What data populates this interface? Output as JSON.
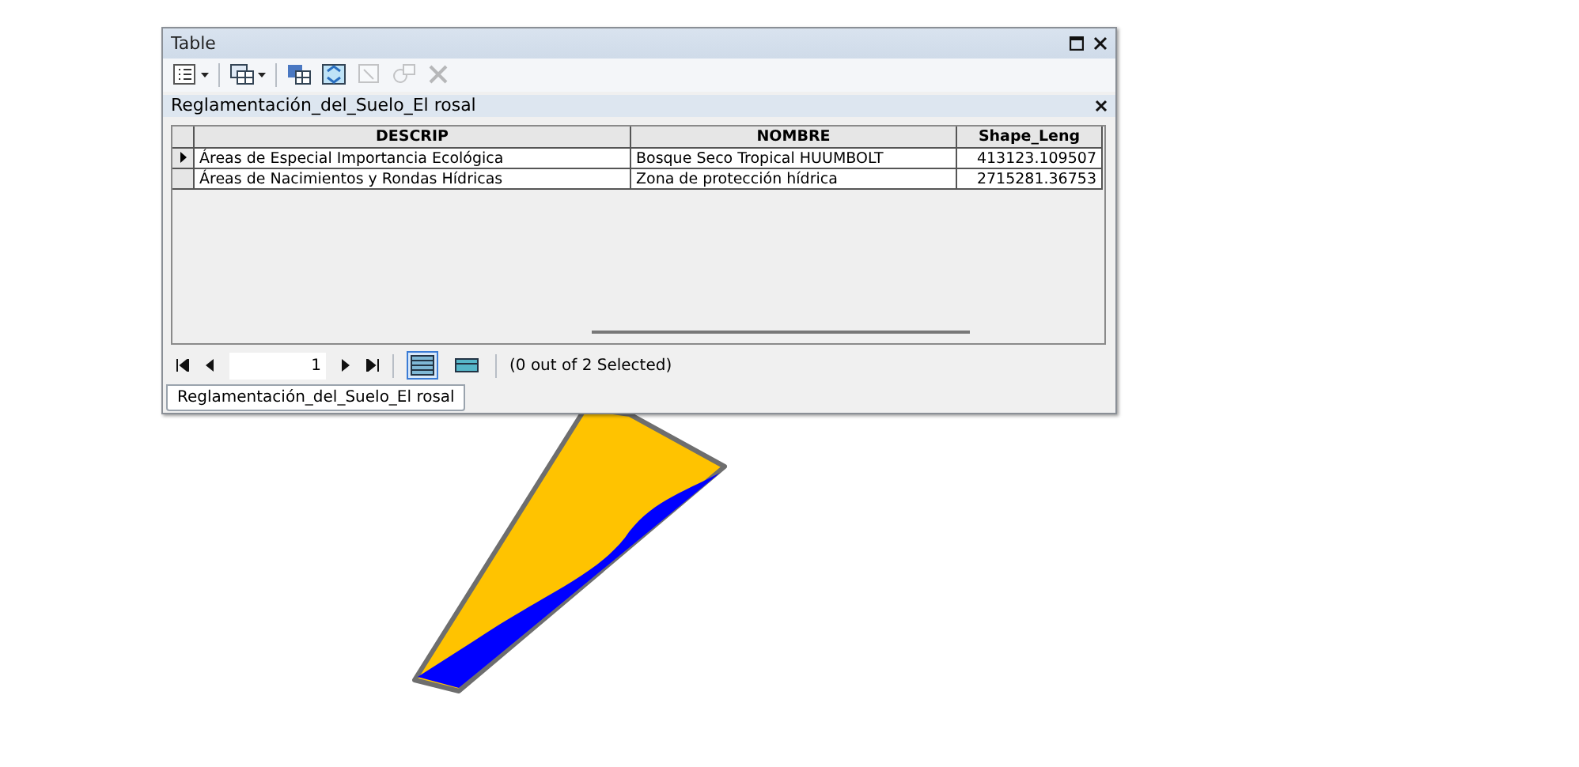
{
  "window": {
    "title": "Table"
  },
  "toolbar": [
    {
      "kind": "options",
      "dropdown": true,
      "disabled": false
    },
    {
      "kind": "related",
      "dropdown": true,
      "disabled": false
    },
    {
      "kind": "select",
      "dropdown": false,
      "disabled": false
    },
    {
      "kind": "switch",
      "dropdown": false,
      "disabled": false
    },
    {
      "kind": "clear",
      "dropdown": false,
      "disabled": true
    },
    {
      "kind": "zoom",
      "dropdown": false,
      "disabled": true
    },
    {
      "kind": "delete",
      "dropdown": false,
      "disabled": true
    }
  ],
  "table": {
    "name": "Reglamentación_del_Suelo_El rosal",
    "columns": [
      "DESCRIP",
      "NOMBRE",
      "Shape_Leng"
    ],
    "rows": [
      {
        "current": true,
        "cells": [
          "Áreas de Especial Importancia Ecológica",
          "Bosque Seco Tropical HUUMBOLT",
          "413123.109507"
        ]
      },
      {
        "current": false,
        "cells": [
          "Áreas de Nacimientos y Rondas Hídricas",
          "Zona de protección hídrica",
          "2715281.36753"
        ]
      }
    ]
  },
  "navigator": {
    "record": "1",
    "views": [
      {
        "kind": "all",
        "selected": true
      },
      {
        "kind": "selected",
        "selected": false
      }
    ],
    "status": "(0 out of 2 Selected)"
  },
  "tabs": [
    {
      "label": "Reglamentación_del_Suelo_El rosal",
      "selected": true
    }
  ]
}
